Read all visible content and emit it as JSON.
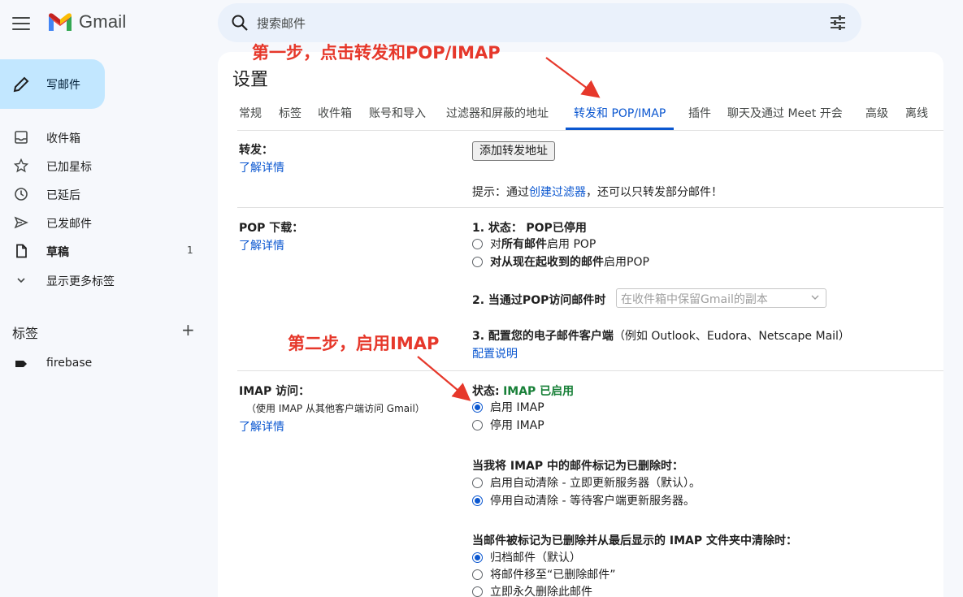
{
  "header": {
    "app_name": "Gmail",
    "search_placeholder": "搜索邮件"
  },
  "sidebar": {
    "compose_label": "写邮件",
    "items": [
      {
        "label": "收件箱",
        "icon": "inbox-icon"
      },
      {
        "label": "已加星标",
        "icon": "star-icon"
      },
      {
        "label": "已延后",
        "icon": "clock-icon"
      },
      {
        "label": "已发邮件",
        "icon": "send-icon"
      },
      {
        "label": "草稿",
        "icon": "draft-icon",
        "count": "1"
      },
      {
        "label": "显示更多标签",
        "icon": "chevron-down-icon"
      }
    ],
    "labels_title": "标签",
    "labels_add": "+",
    "labels": [
      {
        "label": "firebase",
        "icon": "label-icon"
      }
    ]
  },
  "settings": {
    "title": "设置",
    "tabs": [
      "常规",
      "标签",
      "收件箱",
      "账号和导入",
      "过滤器和屏蔽的地址",
      "转发和 POP/IMAP",
      "插件",
      "聊天及通过 Meet 开会",
      "高级",
      "离线"
    ],
    "active_tab": "转发和 POP/IMAP",
    "forwarding": {
      "title": "转发：",
      "learn_more": "了解详情",
      "add_button": "添加转发地址",
      "tip_prefix": "提示：通过",
      "tip_link": "创建过滤器",
      "tip_suffix": "，还可以只转发部分邮件！"
    },
    "pop": {
      "title": "POP 下载：",
      "learn_more": "了解详情",
      "status_label": "1. 状态：",
      "status_value": "POP已停用",
      "option1_pre": "对",
      "option1_bold": "所有邮件",
      "option1_post": "启用 POP",
      "option2_bold": "对从现在起收到的邮件",
      "option2_post": "启用POP",
      "access_label": "2. 当通过POP访问邮件时",
      "access_select": "在收件箱中保留Gmail的副本",
      "client_label": "3. 配置您的电子邮件客户端",
      "client_examples": "（例如 Outlook、Eudora、Netscape Mail）",
      "config_link": "配置说明"
    },
    "imap": {
      "title": "IMAP 访问：",
      "subtitle": "（使用 IMAP 从其他客户端访问 Gmail）",
      "learn_more": "了解详情",
      "status_label": "状态:",
      "status_value": "IMAP 已启用",
      "enable_label": "启用 IMAP",
      "disable_label": "停用 IMAP",
      "deleted_title": "当我将 IMAP 中的邮件标记为已删除时：",
      "auto_expunge_on": "启用自动清除 - 立即更新服务器（默认）。",
      "auto_expunge_off": "停用自动清除 - 等待客户端更新服务器。",
      "expunge_title": "当邮件被标记为已删除并从最后显示的 IMAP 文件夹中清除时：",
      "archive": "归档邮件（默认）",
      "move_trash": "将邮件移至“已删除邮件”",
      "delete_forever": "立即永久删除此邮件"
    }
  },
  "annotations": {
    "step1": "第一步，点击转发和POP/IMAP",
    "step2": "第二步，启用IMAP",
    "color": "#e6382b"
  }
}
